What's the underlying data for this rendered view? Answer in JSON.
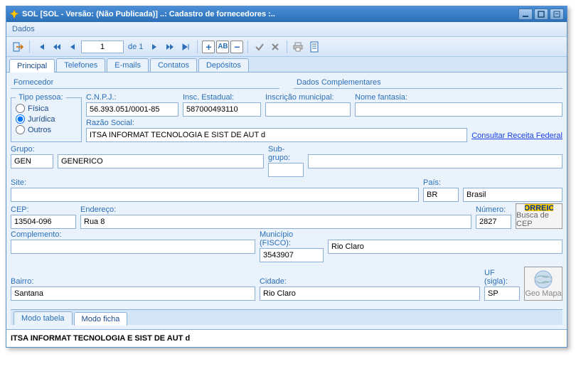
{
  "window": {
    "title": "SOL [SOL - Versão: (Não Publicada)] ..: Cadastro de fornecedores :.."
  },
  "menubar": {
    "dados": "Dados"
  },
  "toolbar": {
    "pagenum": "1",
    "pageinfo": "de 1"
  },
  "tabs": {
    "principal": "Principal",
    "telefones": "Telefones",
    "emails": "E-mails",
    "contatos": "Contatos",
    "depositos": "Depósitos"
  },
  "sections": {
    "fornecedor": "Fornecedor",
    "dados_complementares": "Dados Complementares"
  },
  "tipo_pessoa": {
    "legend": "Tipo pessoa:",
    "fisica": "Física",
    "juridica": "Jurídica",
    "outros": "Outros"
  },
  "labels": {
    "cnpj": "C.N.P.J.:",
    "insc_estadual": "Insc. Estadual:",
    "insc_municipal": "Inscrição municipal:",
    "nome_fantasia": "Nome fantasia:",
    "razao_social": "Razão Social:",
    "consultar_receita": "Consultar Receita Federal",
    "grupo": "Grupo:",
    "subgrupo": "Sub-grupo:",
    "site": "Site:",
    "pais": "País:",
    "cep": "CEP:",
    "endereco": "Endereço:",
    "numero": "Número:",
    "complemento": "Complemento:",
    "municipio_fisco": "Município (FISCO):",
    "bairro": "Bairro:",
    "cidade": "Cidade:",
    "uf": "UF (sigla):",
    "correios": "CORREIOS",
    "busca_cep": "Busca de CEP",
    "geomapa": "Geo Mapa"
  },
  "values": {
    "cnpj": "56.393.051/0001-85",
    "insc_estadual": "587000493110",
    "insc_municipal": "",
    "nome_fantasia": "",
    "razao_social": "ITSA INFORMAT TECNOLOGIA E SIST DE AUT d",
    "grupo_code": "GEN",
    "grupo_name": "GENERICO",
    "subgrupo_code": "",
    "subgrupo_name": "",
    "site": "",
    "pais_code": "BR",
    "pais_name": "Brasil",
    "cep": "13504-096",
    "endereco": "Rua 8",
    "numero": "2827",
    "complemento": "",
    "municipio_code": "3543907",
    "municipio_name": "Rio Claro",
    "bairro": "Santana",
    "cidade": "Rio Claro",
    "uf": "SP"
  },
  "viewtabs": {
    "tabela": "Modo tabela",
    "ficha": "Modo ficha"
  },
  "footer": {
    "text": "ITSA INFORMAT TECNOLOGIA E SIST DE AUT d"
  }
}
